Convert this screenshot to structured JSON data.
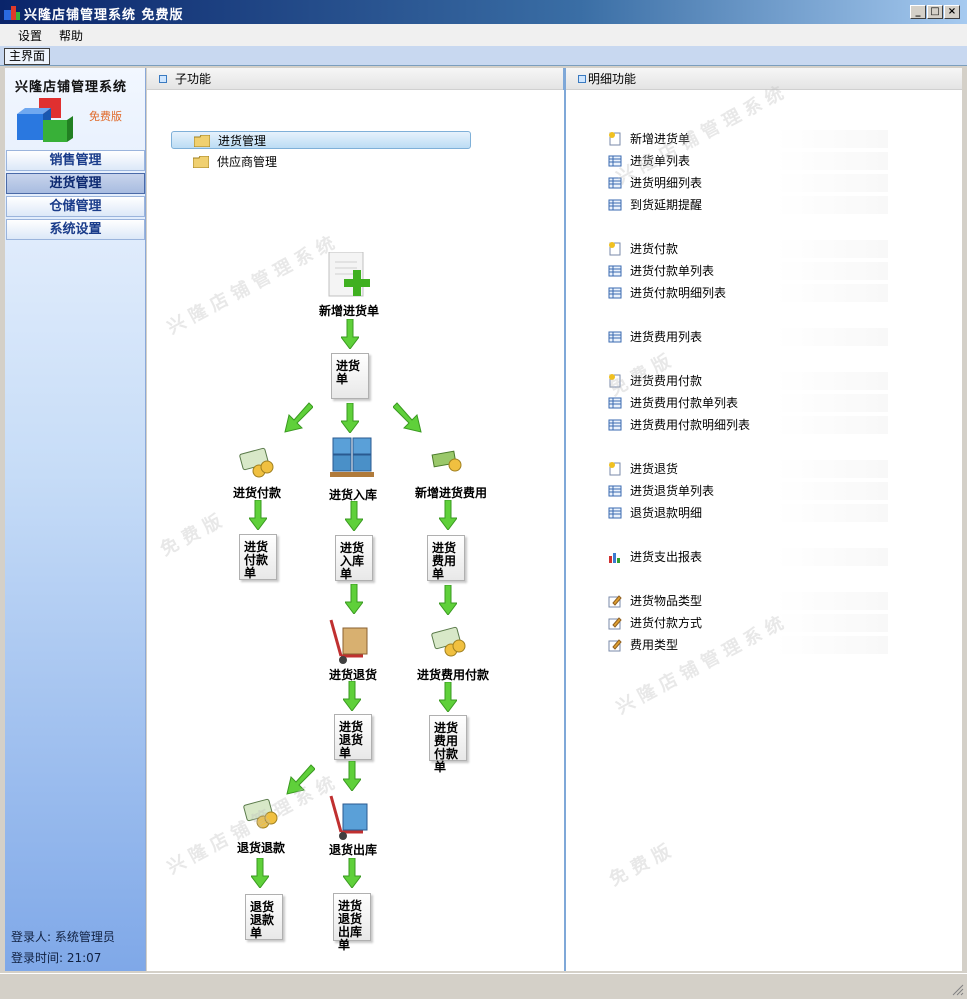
{
  "window": {
    "title": "兴隆店铺管理系统 免费版",
    "buttons": [
      "_",
      "□",
      "×"
    ]
  },
  "menu": {
    "items": [
      "设置",
      "帮助"
    ]
  },
  "tab": {
    "label": "主界面"
  },
  "sidebar": {
    "logo_title": "兴隆店铺管理系统",
    "logo_badge": "免费版",
    "nav": [
      "销售管理",
      "进货管理",
      "仓储管理",
      "系统设置"
    ],
    "active_nav": "进货管理",
    "login_user": "登录人: 系统管理员",
    "login_time": "登录时间: 21:07"
  },
  "sub_panel": {
    "title": "子功能",
    "tree": [
      "进货管理",
      "供应商管理"
    ],
    "selected": "进货管理"
  },
  "flow": {
    "add_order": "新增进货单",
    "order_doc": "进货单",
    "payment": "进货付款",
    "stock_in": "进货入库",
    "add_expense": "新增进货费用",
    "payment_doc": "进货付款单",
    "stock_in_doc": "进货入库单",
    "expense_doc": "进货费用单",
    "return": "进货退货",
    "expense_payment": "进货费用付款",
    "return_doc": "进货退货单",
    "expense_payment_doc": "进货费用付款单",
    "refund": "退货退款",
    "return_out": "退货出库",
    "refund_doc": "退货退款单",
    "return_out_doc": "进货退货出库单"
  },
  "detail_panel": {
    "title": "明细功能",
    "groups": [
      [
        {
          "label": "新增进货单",
          "icon": "new-doc-icon"
        },
        {
          "label": "进货单列表",
          "icon": "table-icon"
        },
        {
          "label": "进货明细列表",
          "icon": "table-icon"
        },
        {
          "label": "到货延期提醒",
          "icon": "table-icon"
        }
      ],
      [
        {
          "label": "进货付款",
          "icon": "new-doc-icon"
        },
        {
          "label": "进货付款单列表",
          "icon": "table-icon"
        },
        {
          "label": "进货付款明细列表",
          "icon": "table-icon"
        }
      ],
      [
        {
          "label": "进货费用列表",
          "icon": "table-icon"
        }
      ],
      [
        {
          "label": "进货费用付款",
          "icon": "new-doc-icon"
        },
        {
          "label": "进货费用付款单列表",
          "icon": "table-icon"
        },
        {
          "label": "进货费用付款明细列表",
          "icon": "table-icon"
        }
      ],
      [
        {
          "label": "进货退货",
          "icon": "new-doc-icon"
        },
        {
          "label": "进货退货单列表",
          "icon": "table-icon"
        },
        {
          "label": "退货退款明细",
          "icon": "table-icon"
        }
      ],
      [
        {
          "label": "进货支出报表",
          "icon": "bar-chart-icon"
        }
      ],
      [
        {
          "label": "进货物品类型",
          "icon": "edit-icon"
        },
        {
          "label": "进货付款方式",
          "icon": "edit-icon"
        },
        {
          "label": "费用类型",
          "icon": "edit-icon"
        }
      ]
    ]
  },
  "watermark": {
    "brand": "兴隆店铺管理系统",
    "badge": "免费版"
  },
  "colors": {
    "title_bar": "#0a246a",
    "arrow": "#5fd03a",
    "accent": "#1a3c8a"
  }
}
